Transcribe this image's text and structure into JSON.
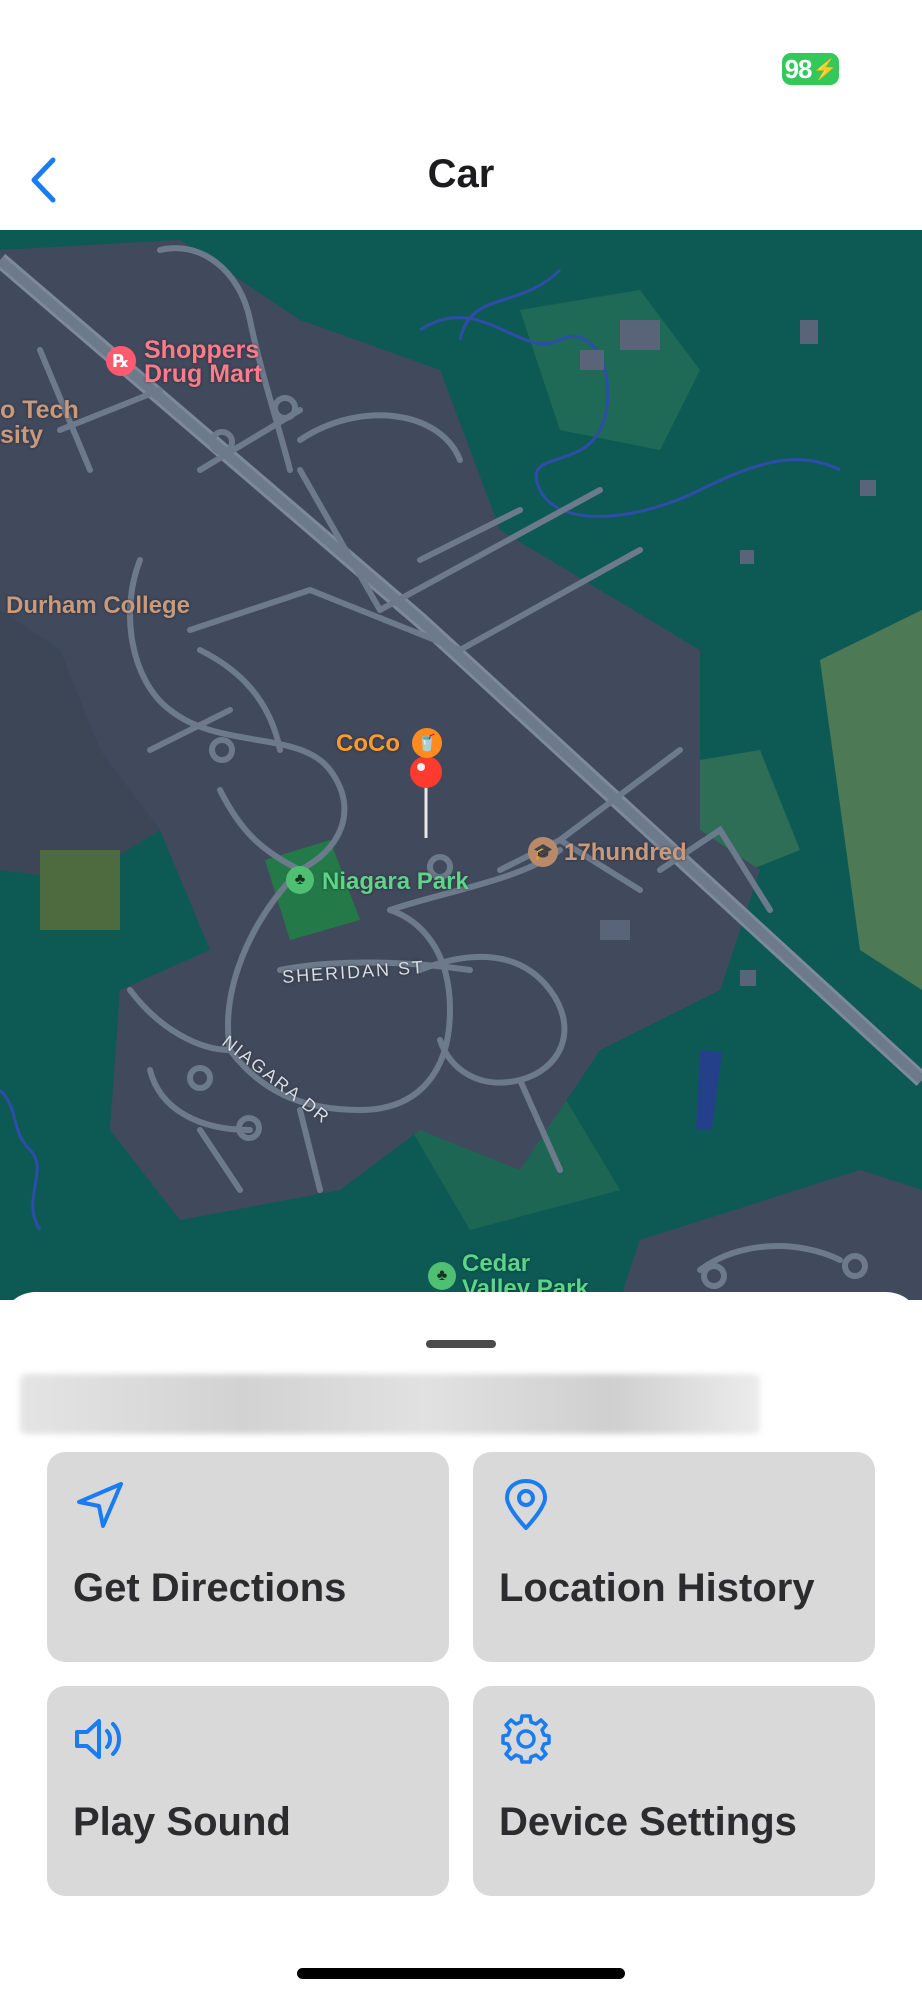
{
  "status_bar": {
    "battery": "98"
  },
  "nav": {
    "title": "Car"
  },
  "map": {
    "labels": {
      "shoppers_line1": "Shoppers",
      "shoppers_line2": "Drug Mart",
      "tech_line1": "o Tech",
      "tech_line2": "sity",
      "durham_college": "Durham College",
      "coco": "CoCo",
      "seventeen_hundred": "17hundred",
      "niagara_park": "Niagara Park",
      "sheridan_st": "SHERIDAN ST",
      "niagara_dr": "NIAGARA DR",
      "cedar_line1": "Cedar",
      "cedar_line2": "Valley Park"
    }
  },
  "actions": {
    "get_directions": "Get Directions",
    "location_history": "Location History",
    "play_sound": "Play Sound",
    "device_settings": "Device Settings"
  },
  "colors": {
    "accent": "#1a7cf2",
    "map_green": "#0d5a55",
    "urban": "#41495c",
    "road": "#6d7a8c",
    "pin": "#ff3b30",
    "battery": "#34c759",
    "tile": "#d9d9d9"
  },
  "icons": [
    "back-chevron-icon",
    "location-arrow-icon",
    "map-pin-icon",
    "speaker-icon",
    "gear-icon"
  ]
}
